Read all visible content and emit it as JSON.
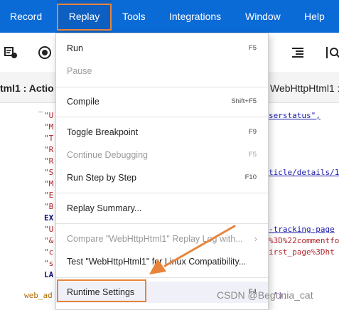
{
  "menubar": {
    "items": [
      {
        "label": "Record"
      },
      {
        "label": "Replay"
      },
      {
        "label": "Tools"
      },
      {
        "label": "Integrations"
      },
      {
        "label": "Window"
      },
      {
        "label": "Help"
      }
    ]
  },
  "tabs": {
    "left_label": "tml1 : Actio",
    "right_label": "WebHttpHtml1 :"
  },
  "code": {
    "lines": [
      {
        "prefix": "\"U",
        "suffix": "serstatus\","
      },
      {
        "prefix": "\"M",
        "suffix": ""
      },
      {
        "prefix": "\"T",
        "suffix": ""
      },
      {
        "prefix": "\"R",
        "suffix": ""
      },
      {
        "prefix": "\"R",
        "suffix": ""
      },
      {
        "prefix": "\"S",
        "suffix": "ticle/details/1"
      },
      {
        "prefix": "\"M",
        "suffix": ""
      },
      {
        "prefix": "\"E",
        "suffix": ""
      },
      {
        "prefix": "\"B",
        "suffix": ""
      },
      {
        "prefix": "EX",
        "suffix": ""
      },
      {
        "prefix": "\"U",
        "suffix": "-tracking-page"
      },
      {
        "prefix": "\"&",
        "suffix": "%3D%22commentfo"
      },
      {
        "prefix": "\"c",
        "suffix": "irst_page%3Dht"
      },
      {
        "prefix": "\"s",
        "suffix": ""
      },
      {
        "prefix": "LA",
        "suffix": ""
      }
    ],
    "bottom_prefix": "web_ad",
    "bottom_suffix": "\");"
  },
  "dropdown": {
    "items": [
      {
        "label": "Run",
        "shortcut": "F5",
        "state": "enabled"
      },
      {
        "label": "Pause",
        "shortcut": "",
        "state": "disabled"
      },
      {
        "label": "Compile",
        "shortcut": "Shift+F5",
        "state": "enabled"
      },
      {
        "label": "Toggle Breakpoint",
        "shortcut": "F9",
        "state": "enabled"
      },
      {
        "label": "Continue Debugging",
        "shortcut": "F5",
        "state": "disabled"
      },
      {
        "label": "Run Step by Step",
        "shortcut": "F10",
        "state": "enabled"
      },
      {
        "label": "Replay Summary...",
        "shortcut": "",
        "state": "enabled"
      },
      {
        "label": "Compare \"WebHttpHtml1\" Replay Log with...",
        "shortcut": "",
        "state": "disabled"
      },
      {
        "label": "Test \"WebHttpHtml1\" for Linux Compatibility...",
        "shortcut": "",
        "state": "enabled"
      },
      {
        "label": "Runtime Settings",
        "shortcut": "F4",
        "state": "selected"
      }
    ],
    "submenu_arrow": "›"
  },
  "watermark": "CSDN @Begonia_cat",
  "colors": {
    "menubar_bg": "#0a6ad6",
    "highlight": "#e8843a",
    "disabled_text": "#9a9a9a"
  }
}
